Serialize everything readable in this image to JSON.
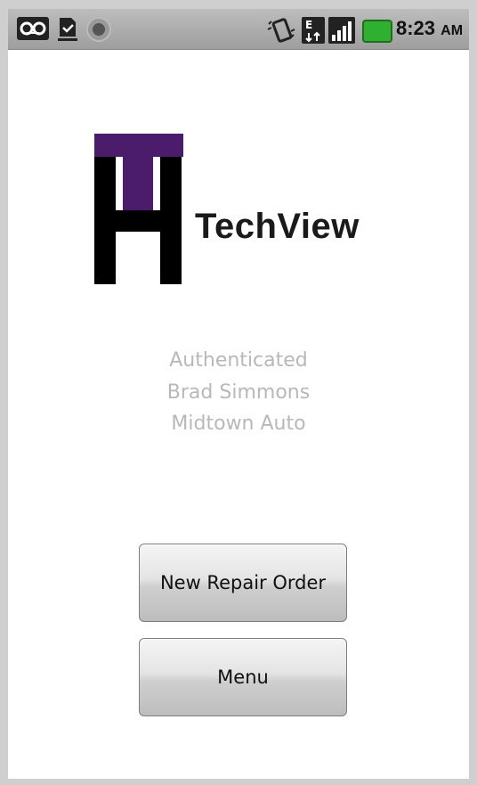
{
  "status_bar": {
    "icons": [
      "voicemail-icon",
      "download-complete-icon",
      "usb-icon",
      "vibrate-icon",
      "data-transfer-icon",
      "signal-icon",
      "battery-icon"
    ],
    "time": "8:23",
    "ampm": "AM"
  },
  "logo": {
    "brand_name": "TechView",
    "accent_color": "#4a1c6b"
  },
  "auth": {
    "status": "Authenticated",
    "user_name": "Brad Simmons",
    "shop_name": "Midtown Auto"
  },
  "actions": {
    "new_repair_order_label": "New Repair Order",
    "menu_label": "Menu"
  }
}
